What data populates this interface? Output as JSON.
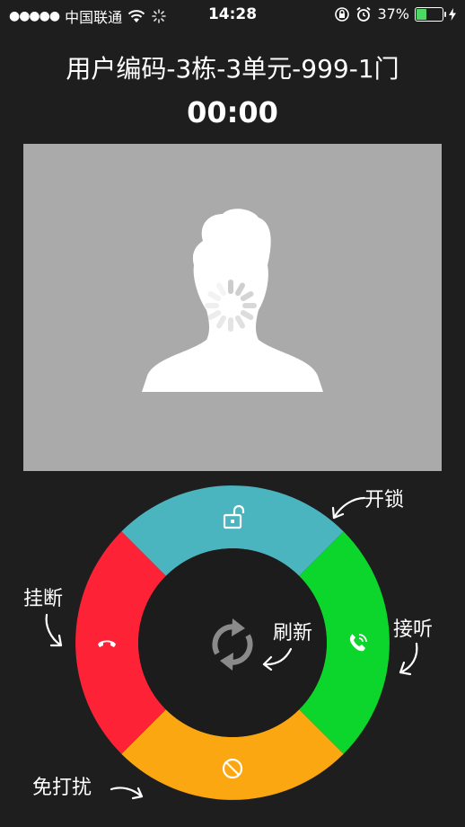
{
  "status_bar": {
    "signal": "●●●●●",
    "carrier": "中国联通",
    "time": "14:28",
    "battery_text": "37%",
    "battery_level": 0.37
  },
  "call": {
    "title": "用户编码-3栋-3单元-999-1门",
    "timer": "00:00"
  },
  "controls": {
    "unlock_label": "开锁",
    "hangup_label": "挂断",
    "answer_label": "接听",
    "refresh_label": "刷新",
    "dnd_label": "免打扰"
  },
  "colors": {
    "background": "#1e1e1e",
    "video_bg": "#aaaaaa",
    "unlock": "#4bb5bf",
    "hangup": "#fe2236",
    "answer": "#0cd52c",
    "dnd": "#fba711",
    "center": "#1c1c1c"
  }
}
